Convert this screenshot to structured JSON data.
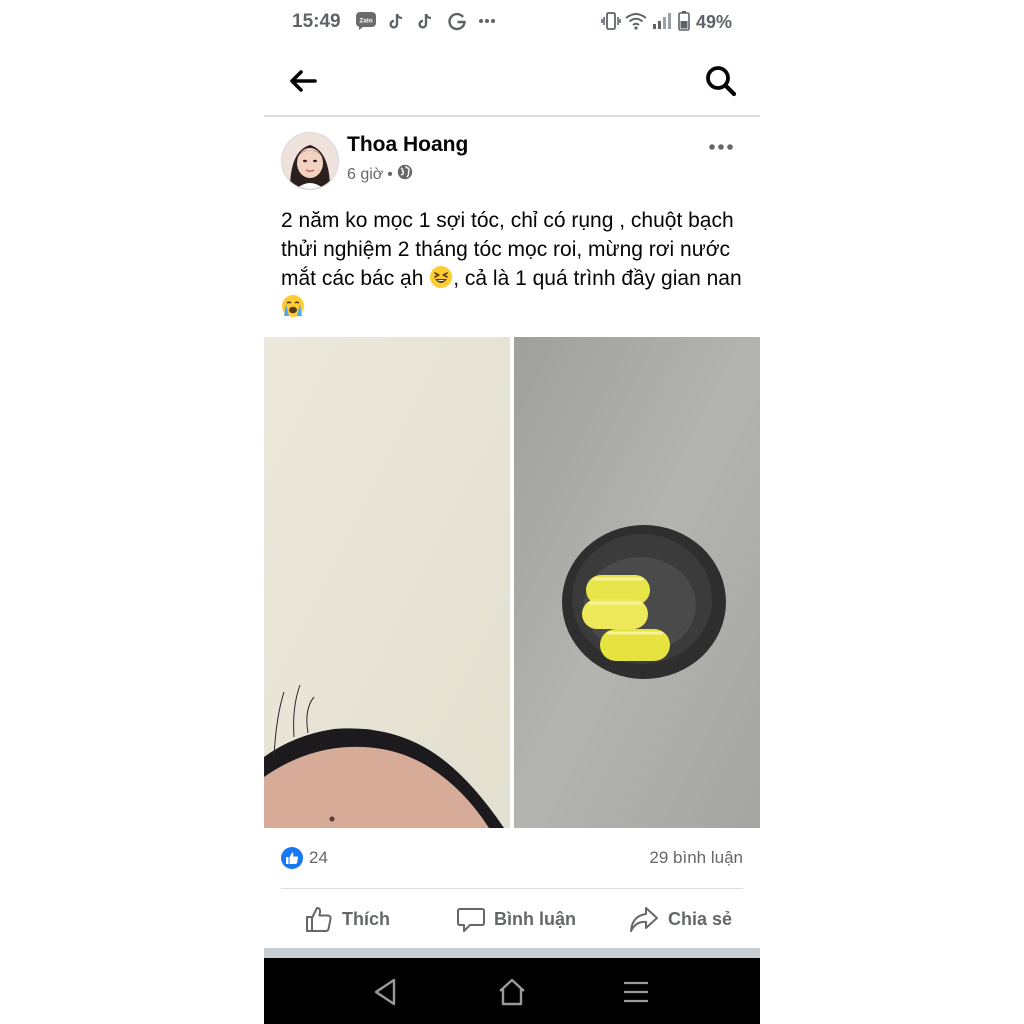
{
  "status_bar": {
    "time": "15:49",
    "battery_percent": "49%",
    "notification_icons": [
      "zalo-icon",
      "tiktok-icon",
      "tiktok-icon",
      "google-icon",
      "more-icon"
    ],
    "system_icons": [
      "vibrate-icon",
      "wifi-icon",
      "signal-icon",
      "battery-icon"
    ]
  },
  "top_nav": {
    "back_icon": "back-arrow-icon",
    "search_icon": "search-icon"
  },
  "post": {
    "author": "Thoa Hoang",
    "time": "6 giờ",
    "time_separator": "•",
    "privacy_icon": "globe-icon",
    "more_icon": "more-horizontal-icon",
    "text_part1": "2 năm ko mọc 1 sợi tóc, chỉ có rụng , chuột bạch thửi nghiệm 2 tháng tóc mọc roi, mừng rơi nước mắt các bác ạh ",
    "text_part2": ", cả là 1 quá trình đầy gian nan ",
    "photos": [
      "photo-forehead-hairline",
      "photo-yellow-pills-in-cap"
    ],
    "reaction_count": "24",
    "comment_count": "29 bình luận",
    "actions": {
      "like": "Thích",
      "comment": "Bình luận",
      "share": "Chia sẻ"
    }
  },
  "colors": {
    "facebook_blue": "#1877f2",
    "secondary_text": "#65676b",
    "primary_text": "#050505",
    "divider": "#dddfe2"
  },
  "system_nav": {
    "buttons": [
      "back-triangle-icon",
      "home-icon",
      "menu-lines-icon"
    ]
  }
}
